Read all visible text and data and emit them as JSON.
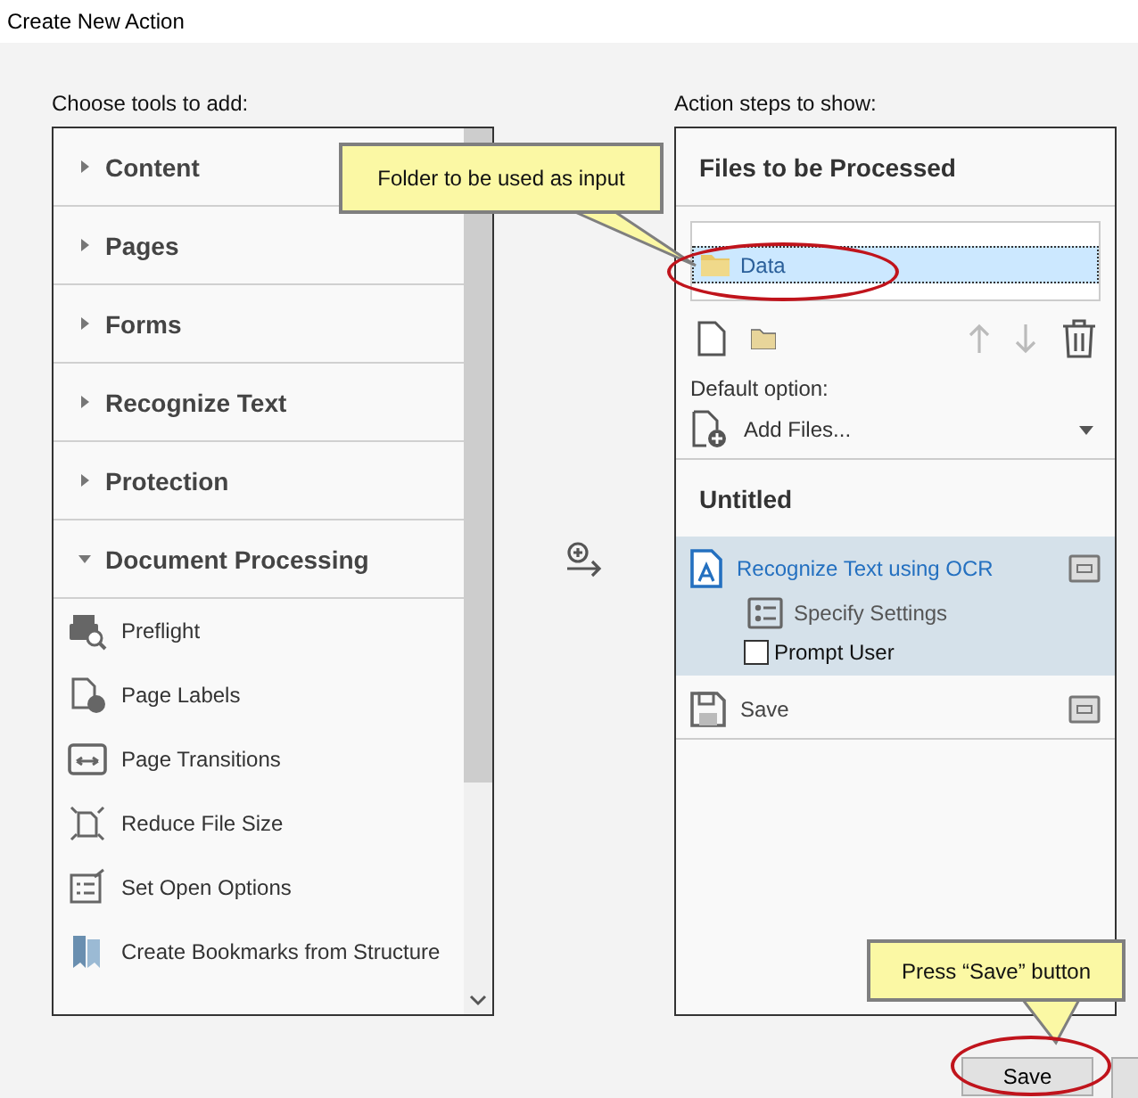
{
  "window": {
    "title": "Create New Action"
  },
  "tools": {
    "label": "Choose tools to add:",
    "categories": [
      {
        "label": "Content",
        "expanded": false
      },
      {
        "label": "Pages",
        "expanded": false
      },
      {
        "label": "Forms",
        "expanded": false
      },
      {
        "label": "Recognize Text",
        "expanded": false
      },
      {
        "label": "Protection",
        "expanded": false
      },
      {
        "label": "Document Processing",
        "expanded": true,
        "items": [
          {
            "label": "Preflight"
          },
          {
            "label": "Page Labels"
          },
          {
            "label": "Page Transitions"
          },
          {
            "label": "Reduce File Size"
          },
          {
            "label": "Set Open Options"
          },
          {
            "label": "Create Bookmarks from Structure"
          }
        ]
      }
    ]
  },
  "steps": {
    "label": "Action steps to show:",
    "files": {
      "title": "Files to be Processed",
      "entries": [
        {
          "label": "Data",
          "selected": true
        }
      ],
      "default_label": "Default option:",
      "default_value": "Add Files..."
    },
    "action": {
      "title": "Untitled",
      "steps": [
        {
          "label": "Recognize Text using OCR",
          "selected": true,
          "settings": "Specify Settings",
          "prompt": {
            "label": "Prompt User",
            "checked": false
          }
        },
        {
          "label": "Save",
          "selected": false
        }
      ]
    }
  },
  "callouts": [
    {
      "text": "Folder to be used as input"
    },
    {
      "text": "Press “Save” button"
    }
  ],
  "buttons": [
    {
      "label": "Save"
    }
  ]
}
